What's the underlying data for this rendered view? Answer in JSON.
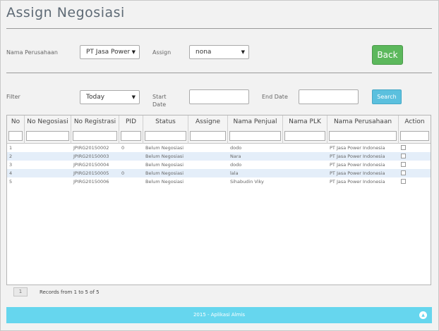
{
  "page": {
    "title": "Assign Negosiasi"
  },
  "form": {
    "nama_perusahaan_label": "Nama Perusahaan",
    "nama_perusahaan_value": "PT Jasa Power",
    "assign_label": "Assign",
    "assign_value": "nona",
    "back_label": "Back",
    "filter_label": "Filter",
    "filter_value": "Today",
    "start_date_label": "Start\nDate",
    "end_date_label": "End Date",
    "search_label": "Search"
  },
  "table": {
    "columns": [
      "No",
      "No Negosiasi",
      "No Registrasi",
      "PID",
      "Status",
      "Assigne",
      "Nama Penjual",
      "Nama PLK",
      "Nama Perusahaan",
      "Action"
    ],
    "rows": [
      {
        "no": "1",
        "no_negosiasi": "",
        "no_registrasi": "JPIRG20150002",
        "pid": "0",
        "status": "Belum Negosiasi",
        "assigne": "",
        "nama_penjual": "dodo",
        "nama_plk": "",
        "nama_perusahaan": "PT Jasa Power Indonesia"
      },
      {
        "no": "2",
        "no_negosiasi": "",
        "no_registrasi": "JPIRG20150003",
        "pid": "",
        "status": "Belum Negosiasi",
        "assigne": "",
        "nama_penjual": "Nara",
        "nama_plk": "",
        "nama_perusahaan": "PT Jasa Power Indonesia"
      },
      {
        "no": "3",
        "no_negosiasi": "",
        "no_registrasi": "JPIRG20150004",
        "pid": "",
        "status": "Belum Negosiasi",
        "assigne": "",
        "nama_penjual": "dodo",
        "nama_plk": "",
        "nama_perusahaan": "PT Jasa Power Indonesia"
      },
      {
        "no": "4",
        "no_negosiasi": "",
        "no_registrasi": "JPIRG20150005",
        "pid": "0",
        "status": "Belum Negosiasi",
        "assigne": "",
        "nama_penjual": "lala",
        "nama_plk": "",
        "nama_perusahaan": "PT Jasa Power Indonesia"
      },
      {
        "no": "5",
        "no_negosiasi": "",
        "no_registrasi": "JPIRG20150006",
        "pid": "",
        "status": "Belum Negosiasi",
        "assigne": "",
        "nama_penjual": "Sihabudin Viky",
        "nama_plk": "",
        "nama_perusahaan": "PT Jasa Power Indonesia"
      }
    ]
  },
  "pager": {
    "page": "1",
    "records_text": "Records from 1 to 5 of 5"
  },
  "footer": {
    "text": "2015 - Aplikasi Almis"
  },
  "colors": {
    "back_button": "#5cb85c",
    "search_button": "#5bc0de",
    "footer": "#66d6ee",
    "row_alt": "#e4eef9"
  }
}
